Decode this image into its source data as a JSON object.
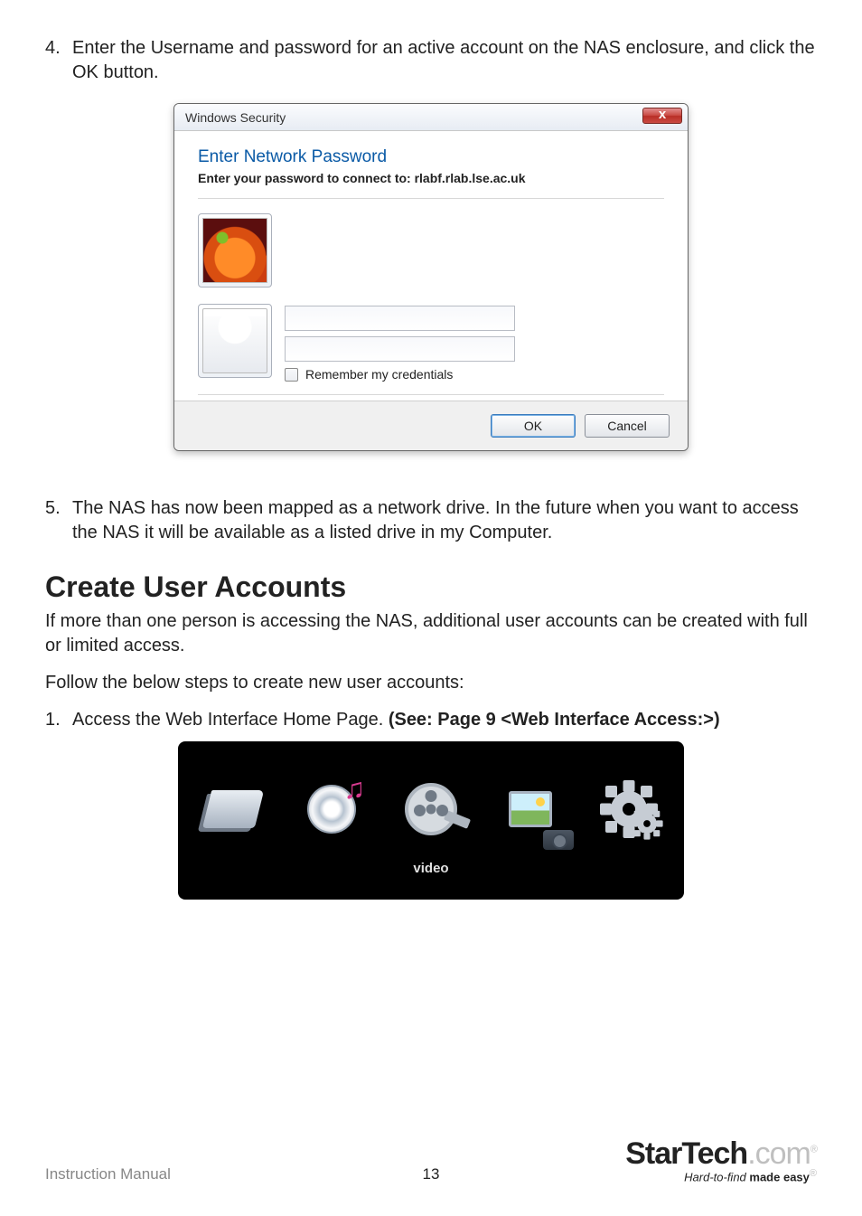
{
  "steps": {
    "s4_num": "4.",
    "s4_text": "Enter the Username and password for an active account on the NAS enclosure, and click the OK button.",
    "s5_num": "5.",
    "s5_text": "The NAS has now been mapped as a network drive. In the future when you want to access the NAS it will be available as a listed drive in my Computer.",
    "s1b_num": "1.",
    "s1b_text_a": "Access the Web Interface Home Page. ",
    "s1b_text_b": "(See: Page 9 <Web Interface Access:>)"
  },
  "dialog": {
    "title": "Windows Security",
    "close": "x",
    "heading": "Enter Network Password",
    "sub": "Enter your password to connect to: rlabf.rlab.lse.ac.uk",
    "remember": "Remember my credentials",
    "ok": "OK",
    "cancel": "Cancel"
  },
  "section": {
    "heading": "Create User Accounts",
    "p1": "If more than one person is accessing the NAS, additional user accounts can be created with full or limited access.",
    "p2": "Follow the below steps to create new user accounts:"
  },
  "webui": {
    "video_label": "video"
  },
  "footer": {
    "manual": "Instruction Manual",
    "page": "13",
    "brand_a": "StarTech",
    "brand_b": ".com",
    "reg": "®",
    "tag_a": "Hard-to-find ",
    "tag_b": "made easy"
  }
}
